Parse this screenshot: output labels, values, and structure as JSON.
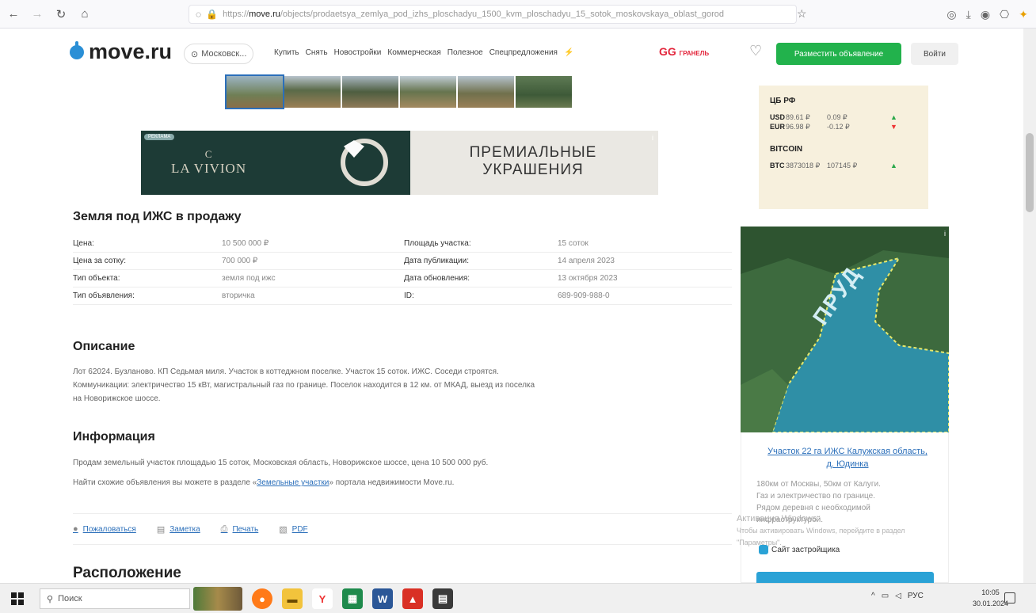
{
  "browser": {
    "url_prefix": "https://",
    "url_host": "move.ru",
    "url_path": "/objects/prodaetsya_zemlya_pod_izhs_ploschadyu_1500_kvm_ploschadyu_15_sotok_moskovskaya_oblast_gorod"
  },
  "header": {
    "logo": "move.ru",
    "region": "Московск...",
    "nav": [
      "Купить",
      "Снять",
      "Новостройки",
      "Коммерческая",
      "Полезное",
      "Спецпредложения"
    ],
    "partner": "GG",
    "partner_small": "ГРАНЕЛЬ",
    "post_button": "Разместить объявление",
    "login_button": "Войти"
  },
  "ad": {
    "badge": "РЕКЛАМА",
    "brand_mark": "C",
    "brand": "LA VIVION",
    "text_line1": "ПРЕМИАЛЬНЫЕ",
    "text_line2": "УКРАШЕНИЯ"
  },
  "listing": {
    "title": "Земля под ИЖС в продажу",
    "properties": [
      {
        "label": "Цена:",
        "value": "10 500 000 ₽",
        "label2": "Площадь участка:",
        "value2": "15 соток"
      },
      {
        "label": "Цена за сотку:",
        "value": "700 000 ₽",
        "label2": "Дата публикации:",
        "value2": "14 апреля 2023"
      },
      {
        "label": "Тип объекта:",
        "value": "земля под ижс",
        "label2": "Дата обновления:",
        "value2": "13 октября 2023"
      },
      {
        "label": "Тип объявления:",
        "value": "вторичка",
        "label2": "ID:",
        "value2": "689-909-988-0"
      }
    ],
    "description_title": "Описание",
    "description_line1": "Лот 62024. Бузланово. КП Седьмая миля. Участок в коттеджном поселке. Участок 15 соток. ИЖС. Соседи строятся.",
    "description_line2": "Коммуникации: электричество 15 кВт, магистральный газ по границе. Поселок находится в 12 км. от МКАД, выезд из поселка",
    "description_line3": "на Новорижское шоссе.",
    "info_title": "Информация",
    "info_line1": "Продам земельный участок площадью 15 соток, Московская область, Новорижское шоссе, цена 10 500 000 руб.",
    "info_line2_pre": "Найти схожие объявления вы можете в разделе «",
    "info_link": "Земельные участки",
    "info_line2_post": "» портала недвижимости Move.ru.",
    "actions": [
      {
        "icon": "complaint-icon",
        "label": "Пожаловаться"
      },
      {
        "icon": "note-icon",
        "label": "Заметка"
      },
      {
        "icon": "print-icon",
        "label": "Печать"
      },
      {
        "icon": "pdf-icon",
        "label": "PDF"
      }
    ],
    "location_title": "Расположение"
  },
  "rates": {
    "cb_label": "ЦБ РФ",
    "rows": [
      {
        "code": "USD",
        "value": "89.61 ₽",
        "change": "0.09 ₽",
        "trend": "▲"
      },
      {
        "code": "EUR",
        "value": "96.98 ₽",
        "change": "-0.12 ₽",
        "trend": "▼"
      }
    ],
    "btc_label": "BITCOIN",
    "btc_row": {
      "code": "BTC",
      "value": "3873018 ₽",
      "change": "107145 ₽",
      "trend": "▲"
    }
  },
  "promo": {
    "pond_label": "ПРУД",
    "link": "Участок 22 га ИЖС Калужская область, д. Юдинка",
    "desc_line1": "180км от Москвы, 50км от Калуги.",
    "desc_line2": "Газ и электричество по границе.",
    "desc_line3": "Рядом деревня с необходимой",
    "desc_line4": "инфраструктурой.",
    "developer": "Сайт застройщика"
  },
  "watermark": {
    "line1": "Активация Windows",
    "line2": "Чтобы активировать Windows, перейдите в раздел",
    "line3": "\"Параметры\"."
  },
  "taskbar": {
    "search": "Поиск",
    "lang": "РУС",
    "time": "10:05",
    "date": "30.01.2024"
  }
}
